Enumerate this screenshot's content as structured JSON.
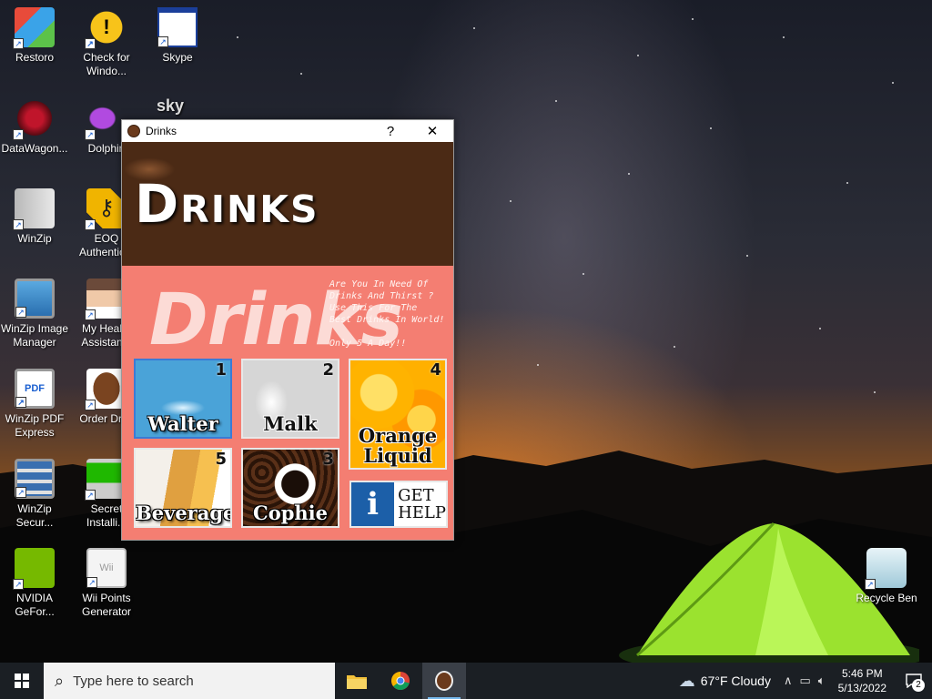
{
  "desktop": {
    "icons": [
      {
        "label": "Restoro",
        "icon": "restoro-icon"
      },
      {
        "label": "Check for\nWindo...",
        "icon": "windows-update-icon"
      },
      {
        "label": "Skype",
        "icon": "skype-icon"
      },
      {
        "label": "DataWagon...",
        "icon": "datawagon-icon"
      },
      {
        "label": "Dolphin",
        "icon": "dolphin-icon"
      },
      {
        "label": "WinZip",
        "icon": "winzip-icon"
      },
      {
        "label": "EOQ\nAuthentic...",
        "icon": "key-icon"
      },
      {
        "label": "WinZip Image\nManager",
        "icon": "winzip-image-icon"
      },
      {
        "label": "My Heal...\nAssistan...",
        "icon": "health-assistant-icon"
      },
      {
        "label": "WinZip PDF\nExpress",
        "icon": "winzip-pdf-icon"
      },
      {
        "label": "Order Dri...",
        "icon": "coffee-bean-icon"
      },
      {
        "label": "WinZip\nSecur...",
        "icon": "winzip-secure-icon"
      },
      {
        "label": "Secret\nInstalli...",
        "icon": "installer-icon"
      },
      {
        "label": "NVIDIA\nGeFor...",
        "icon": "nvidia-icon"
      },
      {
        "label": "Wii Points\nGenerator",
        "icon": "wii-icon"
      },
      {
        "label": "Recycle Ben",
        "icon": "recycle-bin-icon"
      }
    ],
    "sky_label": "sky"
  },
  "window": {
    "title": "Drinks",
    "help_glyph": "?",
    "close_glyph": "✕",
    "banner_title": "Drinks",
    "big_script": "Drinks",
    "tagline": {
      "l1": "Are You In Need Of",
      "l2": "Drinks And Thirst ?",
      "l3": "Use This For The",
      "l4": "Best Drinks In World!",
      "price": "Only 5 A Day!!"
    },
    "tiles": [
      {
        "num": "1",
        "label": "Walter"
      },
      {
        "num": "2",
        "label": "Malk"
      },
      {
        "num": "4",
        "label": "Orange\nLiquid"
      },
      {
        "num": "5",
        "label": "Beverage"
      },
      {
        "num": "3",
        "label": "Cophie"
      }
    ],
    "help": {
      "icon_glyph": "i",
      "l1": "GET",
      "l2": "HELP"
    }
  },
  "taskbar": {
    "search_placeholder": "Type here to search",
    "weather": "67°F  Cloudy",
    "time": "5:46 PM",
    "date": "5/13/2022",
    "notif_count": "2"
  },
  "colors": {
    "window_bg": "#f47e72",
    "help_blue": "#1c5fa8",
    "taskbar": "#1b1f24"
  }
}
